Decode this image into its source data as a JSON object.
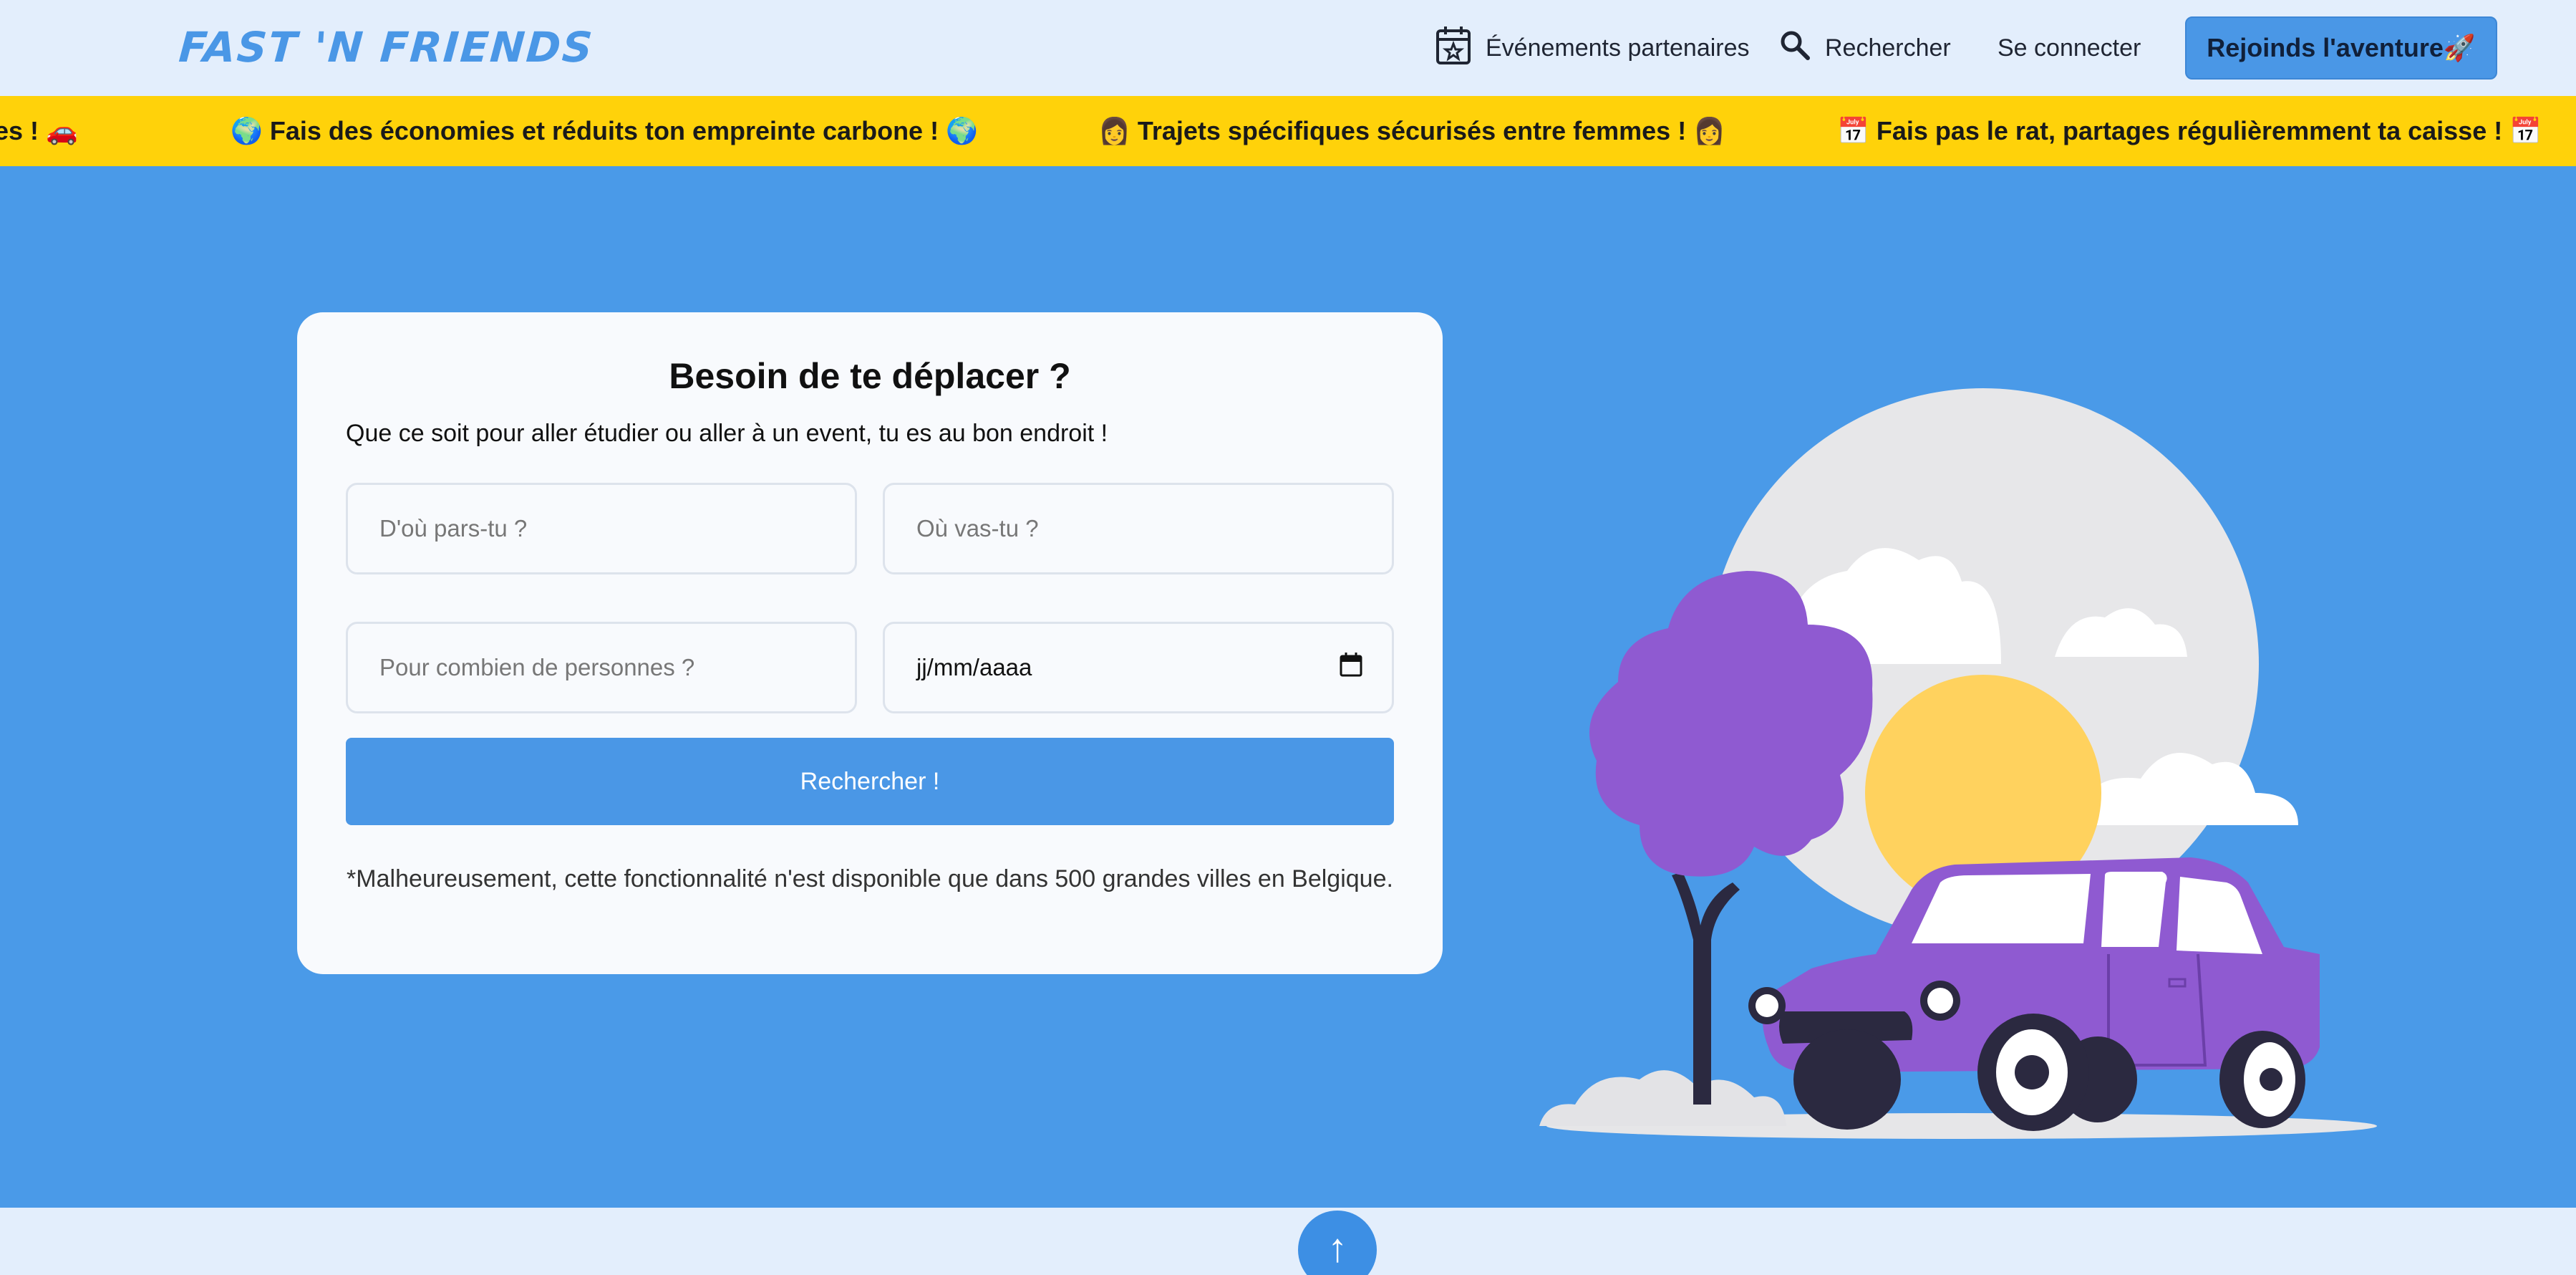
{
  "header": {
    "logo": "FAST 'N FRIENDS",
    "nav": {
      "events": "Événements partenaires",
      "search": "Rechercher",
      "login": "Se connecter"
    },
    "cta": "Rejoinds l'aventure🚀"
  },
  "ticker": {
    "items": [
      "es ! 🚗",
      "🌍 Fais des économies et réduits ton empreinte carbone ! 🌍",
      "👩 Trajets spécifiques sécurisés entre femmes ! 👩",
      "📅 Fais pas le rat, partages régulièremment ta caisse ! 📅"
    ]
  },
  "search_card": {
    "title": "Besoin de te déplacer ?",
    "subtitle": "Que ce soit pour aller étudier ou aller à un event, tu es au bon endroit !",
    "from_placeholder": "D'où pars-tu ?",
    "to_placeholder": "Où vas-tu ?",
    "people_placeholder": "Pour combien de personnes ?",
    "date_placeholder": "jj/mm/aaaa",
    "submit": "Rechercher !",
    "disclaimer": "*Malheureusement, cette fonctionnalité n'est disponible que dans 500 grandes villes en Belgique."
  },
  "scroll_top": "↑",
  "colors": {
    "brand_blue": "#4a97e6",
    "hero_blue": "#4a9ae8",
    "ticker_yellow": "#ffd20a",
    "car_purple": "#8f5ad1",
    "sun_yellow": "#ffd25e"
  }
}
